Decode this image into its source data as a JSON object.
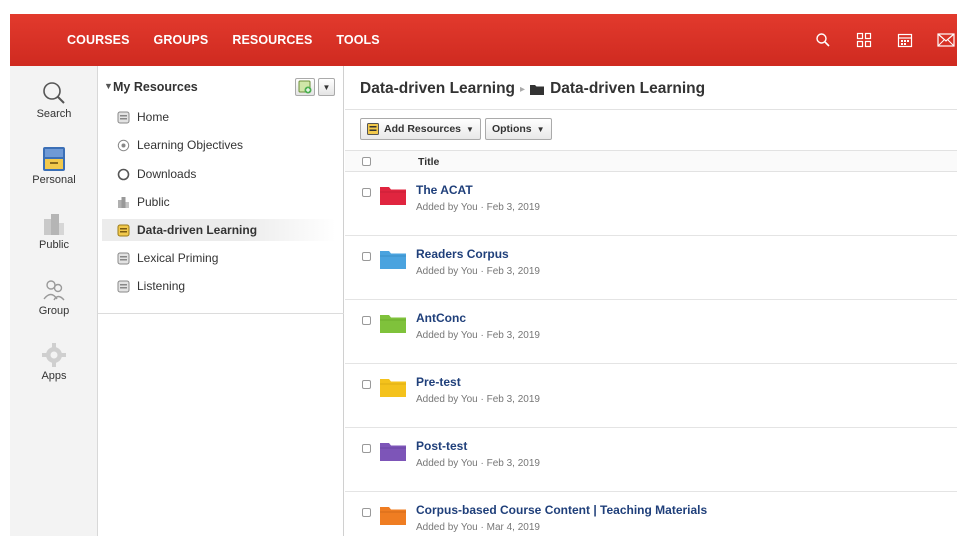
{
  "topnav": {
    "items": [
      "COURSES",
      "GROUPS",
      "RESOURCES",
      "TOOLS"
    ],
    "icons": [
      "search-icon",
      "grid-icon",
      "calendar-icon",
      "mail-icon"
    ]
  },
  "rail": {
    "items": [
      {
        "label": "Search",
        "icon": "search-icon"
      },
      {
        "label": "Personal",
        "icon": "personal-icon"
      },
      {
        "label": "Public",
        "icon": "public-icon"
      },
      {
        "label": "Group",
        "icon": "group-icon"
      },
      {
        "label": "Apps",
        "icon": "apps-icon"
      }
    ]
  },
  "tree": {
    "title": "My Resources",
    "items": [
      {
        "label": "Home",
        "icon": "drawer-icon"
      },
      {
        "label": "Learning Objectives",
        "icon": "target-icon"
      },
      {
        "label": "Downloads",
        "icon": "circle-icon"
      },
      {
        "label": "Public",
        "icon": "public-icon"
      },
      {
        "label": "Data-driven Learning",
        "icon": "drawer-icon",
        "active": true
      },
      {
        "label": "Lexical Priming",
        "icon": "drawer-icon"
      },
      {
        "label": "Listening",
        "icon": "drawer-icon"
      }
    ]
  },
  "main": {
    "breadcrumb": {
      "parent": "Data-driven Learning",
      "current": "Data-driven Learning"
    },
    "toolbar": {
      "add_resources": "Add Resources",
      "options": "Options"
    },
    "table": {
      "title_header": "Title"
    },
    "rows": [
      {
        "title": "The ACAT",
        "meta": "Added by You · Feb 3, 2019",
        "color": "#e0253f"
      },
      {
        "title": "Readers Corpus",
        "meta": "Added by You · Feb 3, 2019",
        "color": "#4aa3df"
      },
      {
        "title": "AntConc",
        "meta": "Added by You · Feb 3, 2019",
        "color": "#7fc23b"
      },
      {
        "title": "Pre-test",
        "meta": "Added by You · Feb 3, 2019",
        "color": "#f4c21c"
      },
      {
        "title": "Post-test",
        "meta": "Added by You · Feb 3, 2019",
        "color": "#7d55b8"
      },
      {
        "title": "Corpus-based Course Content | Teaching Materials",
        "meta": "Added by You · Mar 4, 2019",
        "color": "#ef7d22"
      }
    ]
  },
  "colors": {
    "topbar": "#d8312a",
    "link": "#1f3f7a"
  }
}
